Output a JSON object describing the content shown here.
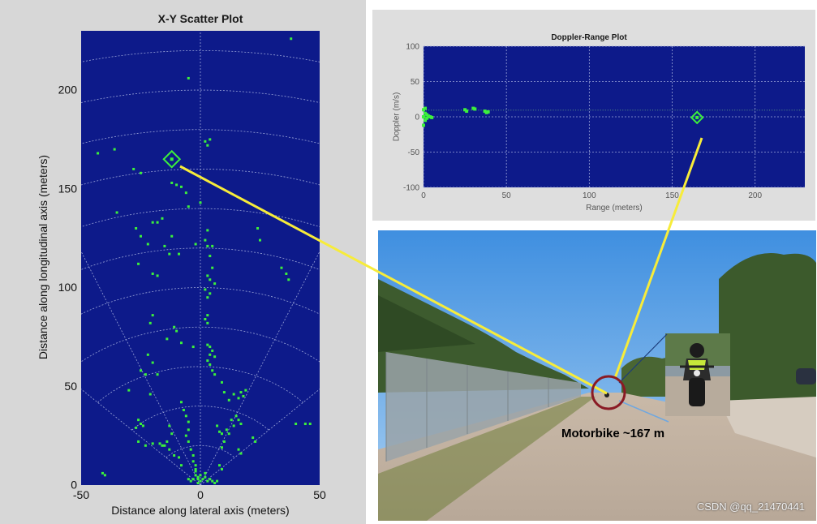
{
  "chart_data": [
    {
      "type": "scatter",
      "title": "X-Y Scatter Plot",
      "xlabel": "Distance along lateral axis (meters)",
      "ylabel": "Distance along longitudinal axis (meters)",
      "xlim": [
        -50,
        50
      ],
      "ylim": [
        0,
        230
      ],
      "xticks": [
        -50,
        0,
        50
      ],
      "yticks": [
        0,
        50,
        100,
        150,
        200
      ],
      "grid": "polar",
      "highlight": {
        "x": -12,
        "y": 165
      },
      "points": [
        [
          38,
          226
        ],
        [
          -5,
          206
        ],
        [
          -36,
          170
        ],
        [
          -43,
          168
        ],
        [
          2,
          174
        ],
        [
          4,
          175
        ],
        [
          3,
          172
        ],
        [
          -28,
          160
        ],
        [
          -25,
          158
        ],
        [
          -12,
          153
        ],
        [
          -10,
          152
        ],
        [
          -8,
          151
        ],
        [
          -6,
          148
        ],
        [
          -35,
          138
        ],
        [
          -20,
          133
        ],
        [
          -18,
          133
        ],
        [
          -16,
          135
        ],
        [
          -5,
          141
        ],
        [
          0,
          143
        ],
        [
          -27,
          130
        ],
        [
          -25,
          126
        ],
        [
          -22,
          122
        ],
        [
          -12,
          126
        ],
        [
          -15,
          121
        ],
        [
          3,
          129
        ],
        [
          2,
          124
        ],
        [
          4,
          116
        ],
        [
          5,
          110
        ],
        [
          24,
          130
        ],
        [
          25,
          124
        ],
        [
          -13,
          117
        ],
        [
          -9,
          117
        ],
        [
          -2,
          122
        ],
        [
          3,
          121
        ],
        [
          5,
          121
        ],
        [
          -26,
          112
        ],
        [
          -20,
          107
        ],
        [
          -18,
          106
        ],
        [
          3,
          106
        ],
        [
          4,
          104
        ],
        [
          6,
          102
        ],
        [
          2,
          99
        ],
        [
          4,
          97
        ],
        [
          3,
          95
        ],
        [
          -20,
          86
        ],
        [
          -21,
          82
        ],
        [
          -11,
          80
        ],
        [
          -10,
          78
        ],
        [
          -14,
          74
        ],
        [
          -8,
          72
        ],
        [
          3,
          86
        ],
        [
          2,
          84
        ],
        [
          3,
          82
        ],
        [
          34,
          110
        ],
        [
          36,
          107
        ],
        [
          37,
          104
        ],
        [
          -3,
          70
        ],
        [
          3,
          71
        ],
        [
          4,
          70
        ],
        [
          5,
          68
        ],
        [
          4,
          66
        ],
        [
          6,
          65
        ],
        [
          3,
          63
        ],
        [
          -22,
          66
        ],
        [
          -20,
          62
        ],
        [
          -25,
          58
        ],
        [
          -23,
          56
        ],
        [
          -18,
          56
        ],
        [
          4,
          61
        ],
        [
          5,
          58
        ],
        [
          6,
          56
        ],
        [
          -21,
          46
        ],
        [
          -30,
          48
        ],
        [
          9,
          52
        ],
        [
          10,
          47
        ],
        [
          12,
          43
        ],
        [
          14,
          46
        ],
        [
          16,
          44
        ],
        [
          17,
          47
        ],
        [
          18,
          45
        ],
        [
          19,
          48
        ],
        [
          -8,
          42
        ],
        [
          -7,
          38
        ],
        [
          -6,
          35
        ],
        [
          -5,
          32
        ],
        [
          -5,
          28
        ],
        [
          -6,
          25
        ],
        [
          -5,
          22
        ],
        [
          -4,
          18
        ],
        [
          -3,
          15
        ],
        [
          -3,
          12
        ],
        [
          -2,
          10
        ],
        [
          -2,
          7
        ],
        [
          -2,
          5
        ],
        [
          7,
          30
        ],
        [
          8,
          27
        ],
        [
          9,
          26
        ],
        [
          11,
          28
        ],
        [
          12,
          26
        ],
        [
          10,
          22
        ],
        [
          9,
          19
        ],
        [
          -13,
          30
        ],
        [
          -12,
          26
        ],
        [
          -14,
          22
        ],
        [
          -15,
          20
        ],
        [
          -13,
          18
        ],
        [
          -11,
          15
        ],
        [
          -9,
          14
        ],
        [
          -8,
          10
        ],
        [
          -26,
          33
        ],
        [
          -25,
          31
        ],
        [
          -27,
          29
        ],
        [
          -24,
          30
        ],
        [
          -26,
          22
        ],
        [
          -23,
          20
        ],
        [
          -20,
          21
        ],
        [
          -17,
          21
        ],
        [
          -16,
          20
        ],
        [
          15,
          35
        ],
        [
          16,
          33
        ],
        [
          17,
          31
        ],
        [
          13,
          33
        ],
        [
          14,
          30
        ],
        [
          22,
          24
        ],
        [
          23,
          22
        ],
        [
          16,
          18
        ],
        [
          17,
          16
        ],
        [
          8,
          10
        ],
        [
          9,
          8
        ],
        [
          -40,
          5
        ],
        [
          -41,
          6
        ],
        [
          40,
          31
        ],
        [
          44,
          31
        ],
        [
          46,
          31
        ],
        [
          -1,
          3
        ],
        [
          0,
          2
        ],
        [
          1,
          3
        ],
        [
          2,
          4
        ],
        [
          3,
          2
        ],
        [
          4,
          3
        ],
        [
          5,
          2
        ],
        [
          -1,
          1
        ],
        [
          -3,
          3
        ],
        [
          -4,
          2
        ],
        [
          -5,
          3
        ],
        [
          0,
          5
        ],
        [
          2,
          6
        ],
        [
          -2,
          8
        ],
        [
          -1,
          4
        ],
        [
          6,
          1
        ],
        [
          7,
          2
        ]
      ]
    },
    {
      "type": "scatter",
      "title": "Doppler-Range Plot",
      "xlabel": "Range (meters)",
      "ylabel": "Doppler (m/s)",
      "xlim": [
        0,
        230
      ],
      "ylim": [
        -100,
        100
      ],
      "xticks": [
        0,
        50,
        100,
        150,
        200
      ],
      "yticks": [
        -100,
        -50,
        0,
        50,
        100
      ],
      "grid": true,
      "highlight": {
        "x": 165,
        "y": -1
      },
      "points": [
        [
          0,
          10
        ],
        [
          0,
          -12
        ],
        [
          1,
          5
        ],
        [
          2,
          3
        ],
        [
          2,
          -2
        ],
        [
          3,
          1
        ],
        [
          4,
          0
        ],
        [
          5,
          -1
        ],
        [
          1,
          -5
        ],
        [
          0,
          0
        ],
        [
          1,
          12
        ],
        [
          25,
          10
        ],
        [
          26,
          8
        ],
        [
          30,
          12
        ],
        [
          31,
          11
        ],
        [
          37,
          8
        ],
        [
          38,
          6
        ],
        [
          39,
          7
        ]
      ]
    }
  ],
  "annotation": {
    "label": "Motorbike ~167 m"
  },
  "watermark": {
    "text": "CSDN @qq_21470441"
  },
  "colors": {
    "plot_bg": "#0d1a8a",
    "point": "#3cf03c",
    "grid": "#9aa4d8",
    "connector": "#f7ec3a",
    "circle": "#8a1a24",
    "sky": "#4f9be3"
  }
}
